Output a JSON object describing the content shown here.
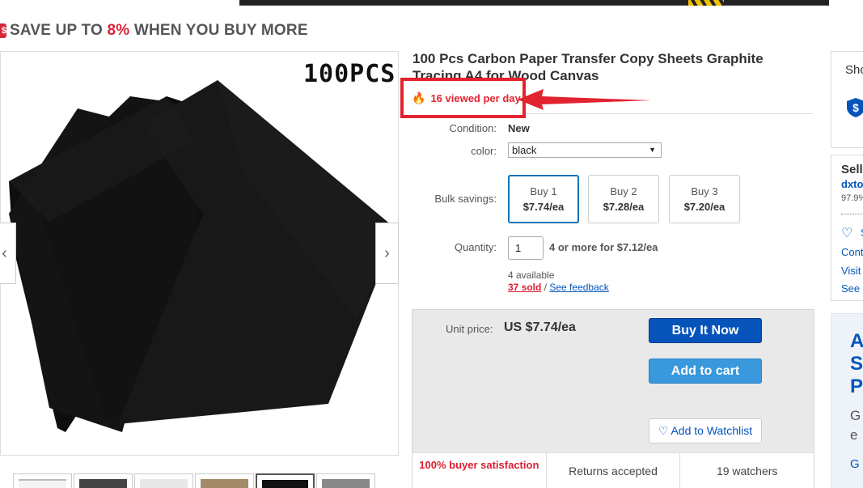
{
  "banner": {
    "save_prefix": "SAVE UP TO ",
    "save_pct": "8%",
    "save_suffix": " WHEN YOU BUY MORE"
  },
  "gallery": {
    "image_label": "100PCS",
    "prev": "‹",
    "next": "›",
    "thumb_count": 6,
    "selected_thumb": 5
  },
  "product": {
    "title": "100 Pcs Carbon Paper Transfer Copy Sheets Graphite Tracing A4 for Wood Canvas",
    "views": "16 viewed per day"
  },
  "fields": {
    "condition_label": "Condition:",
    "condition_value": "New",
    "color_label": "color:",
    "color_value": "black",
    "bulk_label": "Bulk savings:",
    "quantity_label": "Quantity:",
    "quantity_value": "1",
    "quantity_note": "4 or more for $7.12/ea",
    "available": "4 available",
    "sold": "37 sold",
    "sold_sep": " / ",
    "feedback": "See feedback"
  },
  "bulk_options": [
    {
      "label": "Buy 1",
      "price": "$7.74/ea"
    },
    {
      "label": "Buy 2",
      "price": "$7.28/ea"
    },
    {
      "label": "Buy 3",
      "price": "$7.20/ea"
    }
  ],
  "purchase": {
    "unit_label": "Unit price:",
    "unit_price": "US $7.74/ea",
    "buy_now": "Buy It Now",
    "add_cart": "Add to cart",
    "watchlist": "Add to Watchlist"
  },
  "stats": {
    "satisfaction": "100% buyer satisfaction",
    "returns": "Returns accepted",
    "watchers": "19 watchers"
  },
  "right": {
    "shop_title": "Sho",
    "seller_title": "Sell",
    "seller_name": "dxto",
    "seller_pct": "97.9%",
    "save_seller": "S",
    "contact": "Cont",
    "visit": "Visit",
    "see": "See",
    "ad_line1": "A",
    "ad_line2": "S",
    "ad_line3": "P",
    "ad_text1": "G",
    "ad_text2": "e",
    "ad_link": "G"
  },
  "colors": {
    "accent_red": "#e3232f",
    "link_blue": "#0654ba",
    "buy_now_bg": "#0654ba",
    "cart_bg": "#3a98dc"
  },
  "icons": {
    "views": "fire-icon",
    "watchlist": "heart-icon",
    "shield": "shield-dollar-icon"
  }
}
